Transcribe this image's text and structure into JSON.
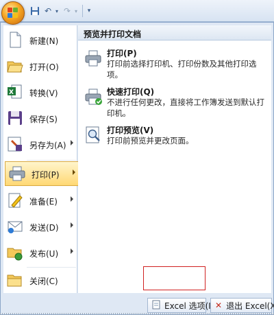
{
  "quick_access": {
    "icons": [
      "office-button-icon",
      "save-icon",
      "undo-icon",
      "redo-icon",
      "customize-icon"
    ]
  },
  "menu": {
    "items": [
      {
        "label": "新建(N)",
        "icon": "new-document-icon",
        "submenu": false
      },
      {
        "label": "打开(O)",
        "icon": "open-folder-icon",
        "submenu": false
      },
      {
        "label": "转换(V)",
        "icon": "convert-icon",
        "submenu": false
      },
      {
        "label": "保存(S)",
        "icon": "save-icon",
        "submenu": false
      },
      {
        "label": "另存为(A)",
        "icon": "save-as-icon",
        "submenu": true
      },
      {
        "label": "打印(P)",
        "icon": "print-icon",
        "submenu": true,
        "active": true
      },
      {
        "label": "准备(E)",
        "icon": "prepare-icon",
        "submenu": true
      },
      {
        "label": "发送(D)",
        "icon": "send-icon",
        "submenu": true
      },
      {
        "label": "发布(U)",
        "icon": "publish-icon",
        "submenu": true
      },
      {
        "label": "关闭(C)",
        "icon": "close-folder-icon",
        "submenu": false
      }
    ]
  },
  "panel": {
    "title": "预览并打印文档",
    "items": [
      {
        "title": "打印(P)",
        "description": "打印前选择打印机、打印份数及其他打印选项。",
        "icon": "printer-icon"
      },
      {
        "title": "快速打印(Q)",
        "description": "不进行任何更改，直接将工作簿发送到默认打印机。",
        "icon": "quick-print-icon"
      },
      {
        "title": "打印预览(V)",
        "description": "打印前预览并更改页面。",
        "icon": "print-preview-icon"
      }
    ]
  },
  "bottom": {
    "options_label": "Excel 选项(I)",
    "exit_label": "退出 Excel(X)"
  },
  "colors": {
    "accent": "#ffd874",
    "highlight_border": "#d02020",
    "menu_bg": "#dfe8f4"
  }
}
